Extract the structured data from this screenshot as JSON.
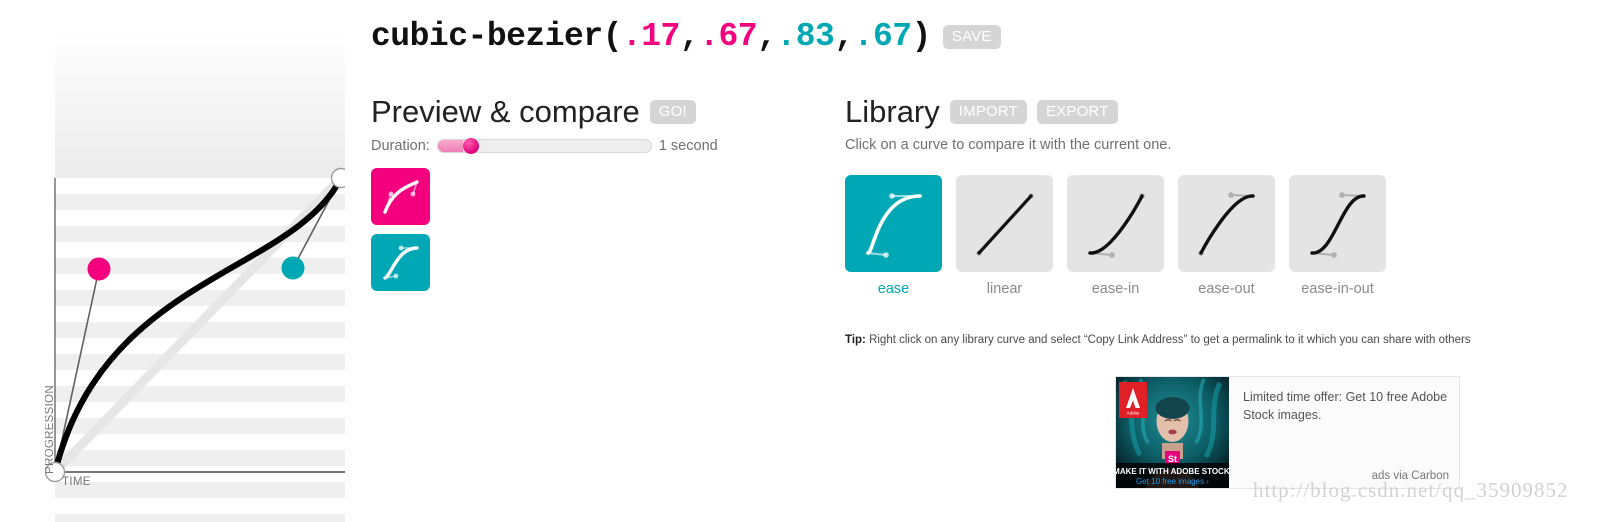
{
  "header": {
    "function_name": "cubic-bezier(",
    "p1x": ".17",
    "comma1": ",",
    "p1y": ".67",
    "comma2": ",",
    "p2x": ".83",
    "comma3": ",",
    "p2y": ".67",
    "close": ")",
    "save_label": "SAVE"
  },
  "editor": {
    "x_axis_label": "TIME",
    "y_axis_label": "PROGRESSION",
    "curve": {
      "p1x": 0.17,
      "p1y": 0.67,
      "p2x": 0.83,
      "p2y": 0.67
    },
    "colors": {
      "handle1": "#f4007f",
      "handle2": "#00a8b5",
      "curve": "#000000",
      "stripe": "#efefef"
    }
  },
  "preview": {
    "title": "Preview & compare",
    "go_label": "GO!",
    "duration_label": "Duration:",
    "duration_value": "1 second",
    "duration_percent": 12,
    "swatches": [
      {
        "name": "current-curve",
        "color": "#f4007f"
      },
      {
        "name": "compare-curve",
        "color": "#00a8b5"
      }
    ]
  },
  "library": {
    "title": "Library",
    "import_label": "IMPORT",
    "export_label": "EXPORT",
    "subtitle": "Click on a curve to compare it with the current one.",
    "selected": "ease",
    "items": [
      {
        "label": "ease",
        "p1x": 0.25,
        "p1y": 0.1,
        "p2x": 0.25,
        "p2y": 1.0,
        "selected": true
      },
      {
        "label": "linear",
        "p1x": 0.0,
        "p1y": 0.0,
        "p2x": 1.0,
        "p2y": 1.0,
        "selected": false
      },
      {
        "label": "ease-in",
        "p1x": 0.42,
        "p1y": 0.0,
        "p2x": 1.0,
        "p2y": 1.0,
        "selected": false
      },
      {
        "label": "ease-out",
        "p1x": 0.0,
        "p1y": 0.0,
        "p2x": 0.58,
        "p2y": 1.0,
        "selected": false
      },
      {
        "label": "ease-in-out",
        "p1x": 0.42,
        "p1y": 0.0,
        "p2x": 0.58,
        "p2y": 1.0,
        "selected": false
      }
    ]
  },
  "tip": {
    "prefix": "Tip:",
    "text": " Right click on any library curve and select “Copy Link Address” to get a permalink to it which you can share with others"
  },
  "ad": {
    "headline": "Limited time offer: Get 10 free Adobe Stock images.",
    "credit": "ads via Carbon",
    "image_caption": "MAKE IT WITH ADOBE STOCK.",
    "image_cta": "Get 10 free images ›",
    "brand": "Adobe",
    "badge": "St"
  },
  "watermark": "http://blog.csdn.net/qq_35909852"
}
